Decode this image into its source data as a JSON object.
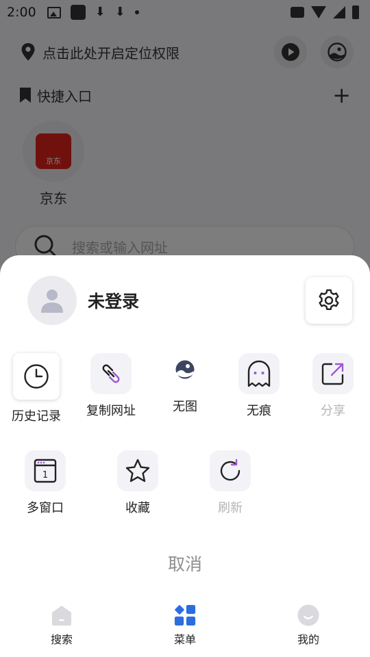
{
  "status_bar": {
    "time": "2:00"
  },
  "background": {
    "location_prompt": "点击此处开启定位权限",
    "quick_entry": {
      "title": "快捷入口",
      "add_symbol": "+"
    },
    "shortcuts": [
      {
        "label": "京东",
        "logo_text": "京东"
      }
    ],
    "search": {
      "placeholder": "搜索或输入网址"
    }
  },
  "sheet": {
    "user": {
      "name": "未登录"
    },
    "menu": [
      {
        "label": "历史记录",
        "icon": "clock-icon",
        "disabled": false
      },
      {
        "label": "复制网址",
        "icon": "link-icon",
        "disabled": false
      },
      {
        "label": "无图",
        "icon": "no-image-icon",
        "disabled": false
      },
      {
        "label": "无痕",
        "icon": "ghost-icon",
        "disabled": false
      },
      {
        "label": "分享",
        "icon": "share-icon",
        "disabled": true
      },
      {
        "label": "多窗口",
        "icon": "multi-window-icon",
        "badge": "1",
        "disabled": false
      },
      {
        "label": "收藏",
        "icon": "star-icon",
        "disabled": false
      },
      {
        "label": "刷新",
        "icon": "refresh-icon",
        "disabled": true
      }
    ],
    "cancel_label": "取消"
  },
  "tab_bar": [
    {
      "label": "搜索",
      "icon": "home-icon"
    },
    {
      "label": "菜单",
      "icon": "menu-grid-icon",
      "active": true
    },
    {
      "label": "我的",
      "icon": "profile-face-icon"
    }
  ],
  "colors": {
    "accent": "#2b6de0",
    "accent_purple": "#9b59d0",
    "icon_dark": "#222222",
    "disabled_text": "#b4b4b8",
    "overlay": "rgba(0,0,0,0.5)"
  }
}
